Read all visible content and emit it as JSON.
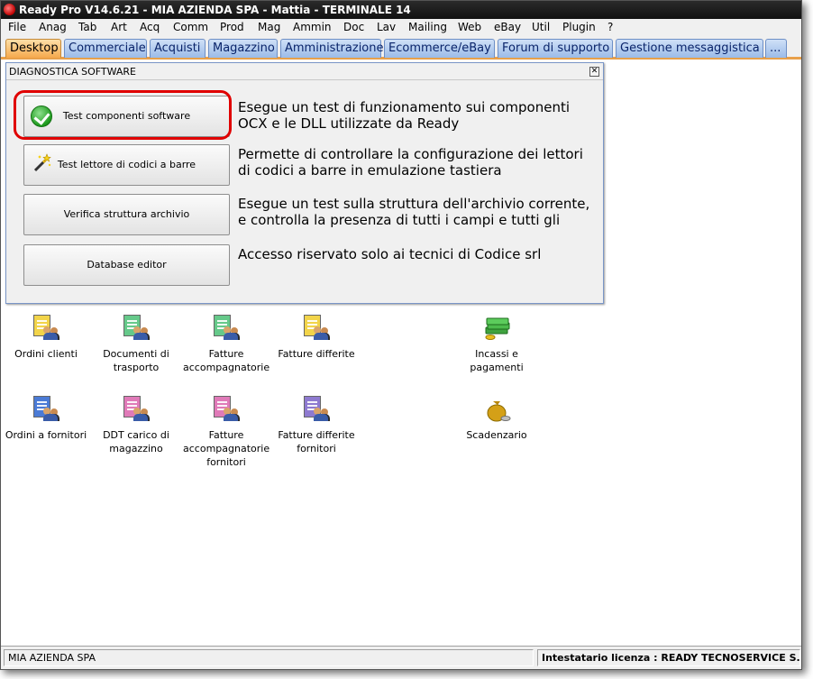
{
  "window": {
    "title": "Ready Pro V14.6.21 - MIA AZIENDA SPA - Mattia - TERMINALE 14"
  },
  "menu": [
    "File",
    "Anag",
    "Tab",
    "Art",
    "Acq",
    "Comm",
    "Prod",
    "Mag",
    "Ammin",
    "Doc",
    "Lav",
    "Mailing",
    "Web",
    "eBay",
    "Util",
    "Plugin",
    "?"
  ],
  "tabs": [
    "Desktop",
    "Commerciale",
    "Acquisti",
    "Magazzino",
    "Amministrazione",
    "Ecommerce/eBay",
    "Forum di supporto",
    "Gestione messaggistica",
    "..."
  ],
  "dialog": {
    "title": "DIAGNOSTICA SOFTWARE",
    "close": "✕",
    "items": [
      {
        "button": "Test componenti software",
        "description": "Esegue un test di funzionamento sui componenti OCX e le DLL utilizzate da Ready",
        "icon": "check-icon"
      },
      {
        "button": "Test lettore di codici a barre",
        "description": "Permette di controllare la configurazione dei lettori di codici a barre in emulazione tastiera",
        "icon": "magic-wand-icon"
      },
      {
        "button": "Verifica struttura archivio",
        "description": "Esegue un test sulla struttura dell'archivio corrente, e controlla la presenza di tutti i campi e tutti gli indici",
        "icon": ""
      },
      {
        "button": "Database editor",
        "description": "Accesso riservato solo ai tecnici di Codice srl",
        "icon": ""
      }
    ]
  },
  "desktop_icons": [
    {
      "label": "Ordini clienti",
      "color": "#f2d44a"
    },
    {
      "label": "Documenti di trasporto",
      "color": "#66c98a"
    },
    {
      "label": "Fatture accompagnatorie",
      "color": "#66c98a"
    },
    {
      "label": "Fatture differite",
      "color": "#f2d44a"
    },
    {
      "label": "Incassi e pagamenti",
      "color": "#3fa33f"
    },
    {
      "label": "Ordini a fornitori",
      "color": "#4b7bd6"
    },
    {
      "label": "DDT carico di magazzino",
      "color": "#e07ab8"
    },
    {
      "label": "Fatture accompagnatorie fornitori",
      "color": "#e07ab8"
    },
    {
      "label": "Fatture differite fornitori",
      "color": "#8e7ad0"
    },
    {
      "label": "Scadenzario",
      "color": "#d4a017"
    }
  ],
  "status": {
    "company": "MIA AZIENDA SPA",
    "license": "Intestatario licenza : READY TECNOSERVICE S.R."
  }
}
